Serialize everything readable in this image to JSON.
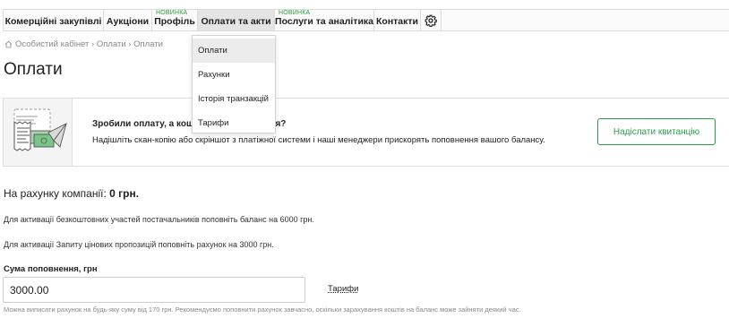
{
  "nav": {
    "items": [
      {
        "label": "Комерційні закупівлі",
        "badge": ""
      },
      {
        "label": "Аукціони",
        "badge": ""
      },
      {
        "label": "Профіль",
        "badge": "НОВИНКА"
      },
      {
        "label": "Оплати та акти",
        "badge": "",
        "active": true
      },
      {
        "label": "Послуги та аналітика",
        "badge": "НОВИНКА"
      },
      {
        "label": "Контакти",
        "badge": ""
      }
    ],
    "settings_icon": "gear-icon"
  },
  "dropdown": {
    "items": [
      "Оплати",
      "Рахунки",
      "Історія транзакцій",
      "Тарифи"
    ],
    "highlighted": "Оплати"
  },
  "breadcrumb": {
    "icon": "home-icon",
    "text": "Особистий кабінет › Оплати › Оплати"
  },
  "page": {
    "title": "Оплати"
  },
  "banner": {
    "title": "Зробили оплату, а кошти не зарахувалися?",
    "text": "Надішліть скан-копію або скріншот з платіжної системи і наші менеджери прискорять поповнення вашого балансу.",
    "button": "Надіслати квитанцію",
    "accent": "#2a9d4a"
  },
  "balance": {
    "label": "На рахунку компанії:",
    "value": "0 грн."
  },
  "info": {
    "line1": "Для активації безкоштовних участей постачальників поповніть баланс на 6000 грн.",
    "line2": "Для активації Запиту цінових пропозицій поповніть рахунок на 3000 грн."
  },
  "amount": {
    "label": "Сума поповнення, грн",
    "value": "3000.00",
    "tariffs_link": "Тарифи",
    "hint": "Можна виписати рахунок на будь-яку суму від 170 грн. Рекомендуємо поповнити рахунок завчасно, оскільки зарахування коштів на баланс може зайняти деякий час."
  }
}
